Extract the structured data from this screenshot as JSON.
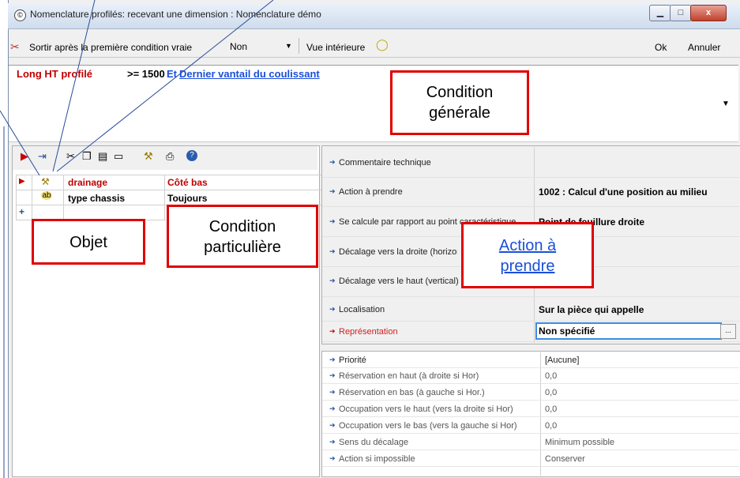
{
  "window": {
    "title": "Nomenclature profilés: recevant une dimension : Nomenclature démo",
    "title_icon": "copyright-like-icon",
    "minimize": "▁",
    "maximize": "□",
    "close": "x"
  },
  "toolbar": {
    "exit_label": "Sortir après la première condition vraie",
    "exit_value": "Non",
    "view_label": "Vue intérieure",
    "ok": "Ok",
    "cancel": "Annuler"
  },
  "condition": {
    "part1": "Long HT profilé",
    "part2": ">= 1500",
    "part3": "Et",
    "part4": "Dernier vantail du coulissant"
  },
  "grid": {
    "rows": [
      {
        "icon": "drill-icon",
        "object": "drainage",
        "condition": "Côté bas",
        "header": true
      },
      {
        "icon": "ab-tag-icon",
        "object": "type chassis",
        "condition": "Toujours",
        "header": false
      }
    ],
    "add_row_glyph": "+"
  },
  "properties": [
    {
      "label": "Commentaire technique",
      "value": ""
    },
    {
      "label": "Action à prendre",
      "value": "1002 : Calcul d'une position au milieu"
    },
    {
      "label": "Se calcule par rapport au point caractéristique",
      "value": "Point de feuillure droite"
    },
    {
      "label": "Décalage vers la droite (horizontal)",
      "value": ""
    },
    {
      "label": "Décalage vers le haut (vertical)",
      "value": ""
    },
    {
      "label": "Localisation",
      "value": "Sur la pièce qui appelle"
    },
    {
      "label": "Représentation",
      "value": "Non spécifié"
    }
  ],
  "details": [
    {
      "label": "Priorité",
      "value": "[Aucune]"
    },
    {
      "label": "Réservation en haut (à droite si Hor)",
      "value": "0,0"
    },
    {
      "label": "Réservation en bas (à gauche si Hor.)",
      "value": "0,0"
    },
    {
      "label": "Occupation vers le haut (vers la droite si Hor)",
      "value": "0,0"
    },
    {
      "label": "Occupation vers le bas (vers la gauche si Hor)",
      "value": "0,0"
    },
    {
      "label": "Sens du décalage",
      "value": "Minimum possible"
    },
    {
      "label": "Action si impossible",
      "value": "Conserver"
    }
  ],
  "annotations": {
    "condition_generale": [
      "Condition",
      "générale"
    ],
    "objet": "Objet",
    "condition_particuliere": [
      "Condition",
      "particulière"
    ],
    "action": [
      "Action à",
      "prendre"
    ]
  },
  "colors": {
    "condition_red": "#c00000",
    "link_blue": "#1a4fd8",
    "callout_border": "#e00000"
  }
}
